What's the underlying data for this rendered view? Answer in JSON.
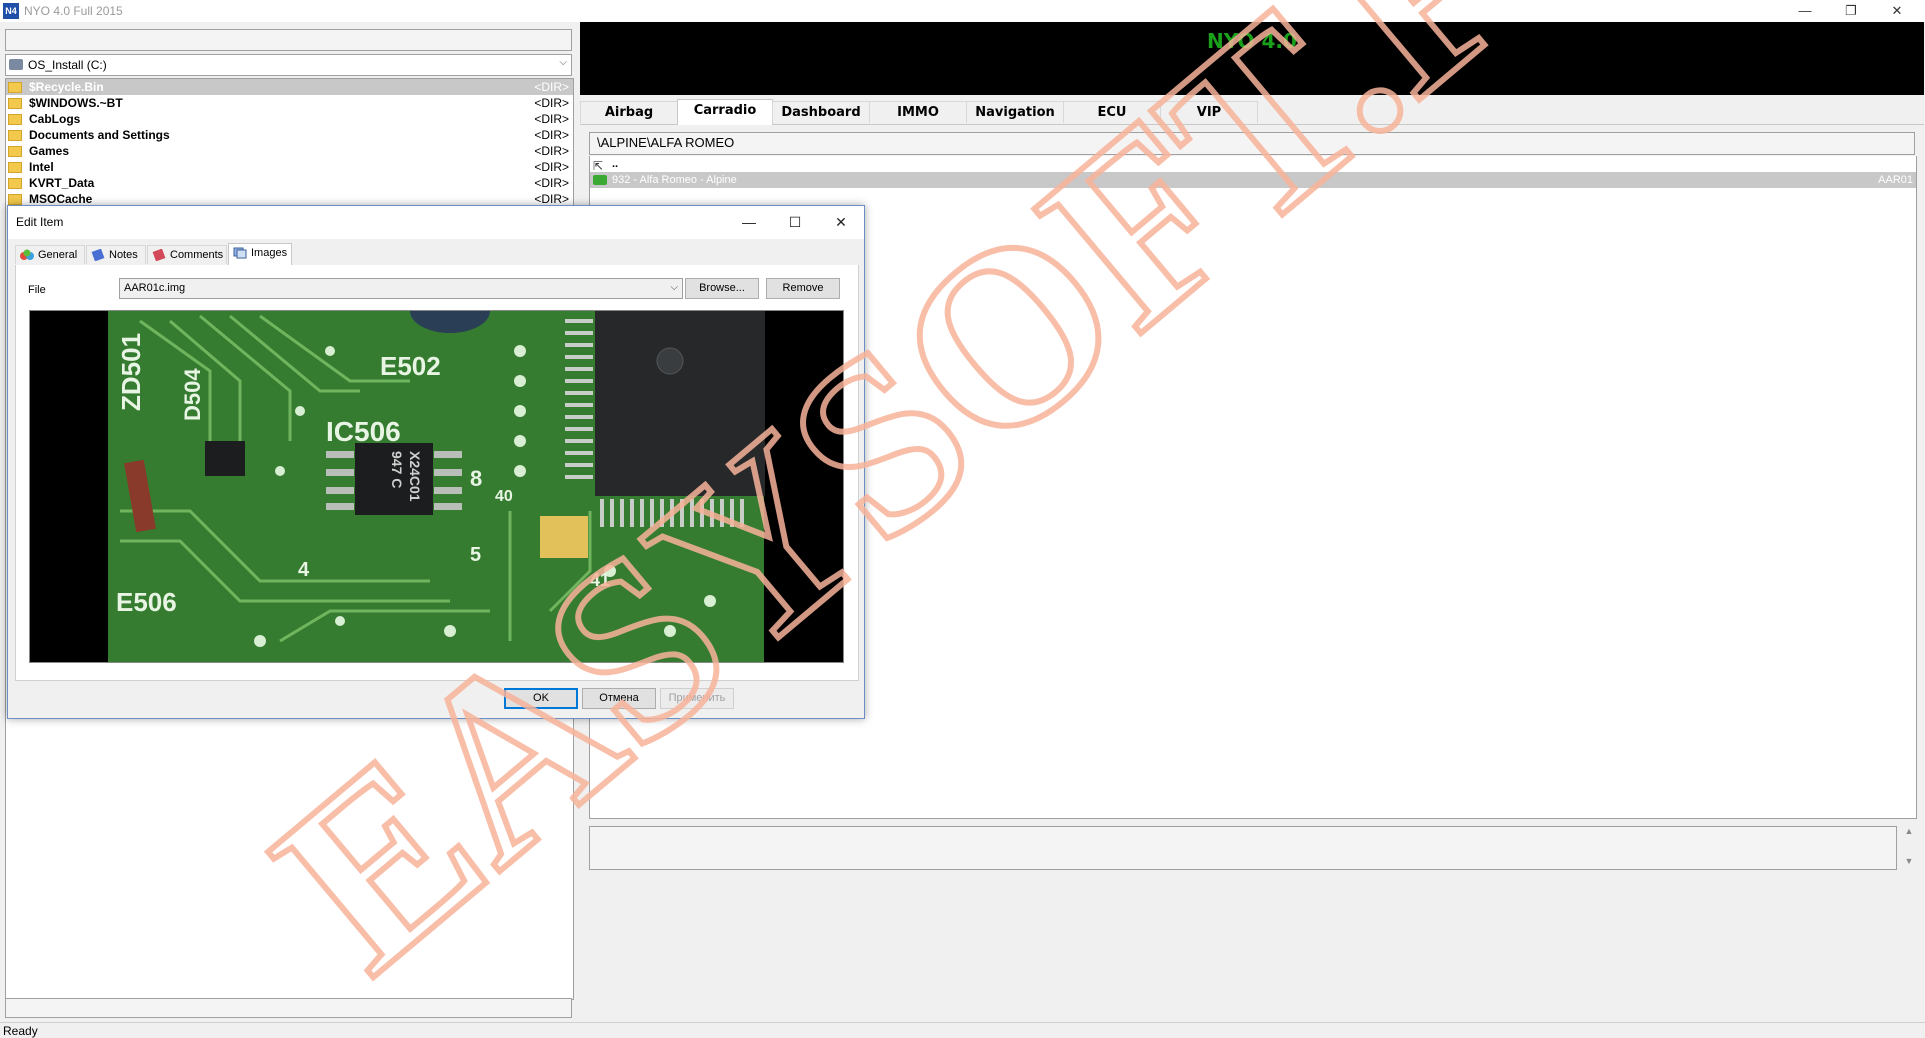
{
  "window": {
    "title": "NYO 4.0 Full 2015",
    "icon_text": "N4",
    "controls": {
      "minimize": "—",
      "restore": "❐",
      "close": "✕"
    }
  },
  "left": {
    "drive": "OS_Install (C:)",
    "files": [
      {
        "name": "$Recycle.Bin",
        "type": "<DIR>"
      },
      {
        "name": "$WINDOWS.~BT",
        "type": "<DIR>"
      },
      {
        "name": "CabLogs",
        "type": "<DIR>"
      },
      {
        "name": "Documents and Settings",
        "type": "<DIR>"
      },
      {
        "name": "Games",
        "type": "<DIR>"
      },
      {
        "name": "Intel",
        "type": "<DIR>"
      },
      {
        "name": "KVRT_Data",
        "type": "<DIR>"
      },
      {
        "name": "MSOCache",
        "type": "<DIR>"
      }
    ]
  },
  "right": {
    "banner_title": "NYO 4.0",
    "tabs": [
      "Airbag",
      "Carradio",
      "Dashboard",
      "IMMO",
      "Navigation",
      "ECU",
      "VIP"
    ],
    "active_tab": "Carradio",
    "path": "\\ALPINE\\ALFA ROMEO",
    "items": [
      {
        "label": "..",
        "code": ""
      },
      {
        "label": "932 - Alfa Romeo - Alpine",
        "code": "AAR01"
      }
    ]
  },
  "status": {
    "text": "Ready"
  },
  "dialog": {
    "title": "Edit Item",
    "controls": {
      "minimize": "—",
      "maximize": "☐",
      "close": "✕"
    },
    "tabs": [
      "General",
      "Notes",
      "Comments",
      "Images"
    ],
    "active_tab": "Images",
    "file_label": "File",
    "file_value": "AAR01c.img",
    "browse_label": "Browse...",
    "remove_label": "Remove",
    "ok_label": "OK",
    "cancel_label": "Отмена",
    "apply_label": "Применить",
    "image_labels": [
      "ZD501",
      "D504",
      "E502",
      "IC506",
      "X24C01",
      "947 C",
      "E506",
      "8",
      "40",
      "4",
      "5",
      "41"
    ]
  },
  "watermark": {
    "text": "EASYSOFT.PW",
    "color": "#f7b39a"
  }
}
